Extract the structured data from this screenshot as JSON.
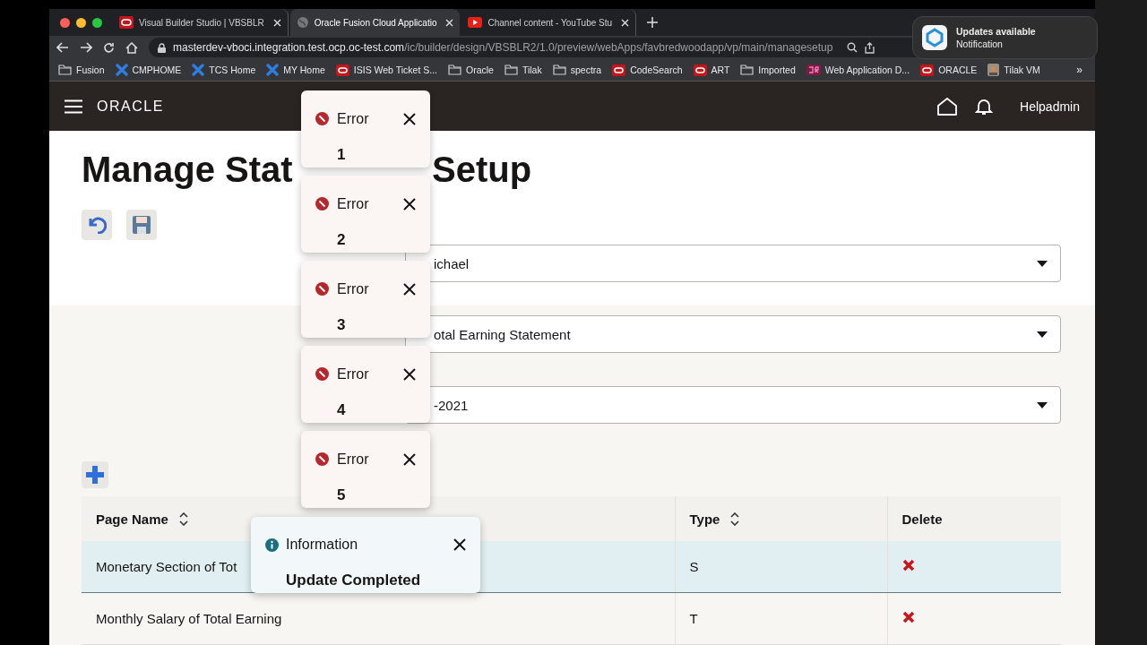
{
  "desktop_notification": {
    "title": "Updates available",
    "subtitle": "Notification"
  },
  "browser": {
    "tabs": [
      {
        "title": "Visual Builder Studio | VBSBLR",
        "selected": false
      },
      {
        "title": "Oracle Fusion Cloud Applicatio",
        "selected": true
      },
      {
        "title": "Channel content - YouTube Stu",
        "selected": false
      }
    ],
    "url_host": "masterdev-vboci.integration.test.ocp.oc-test.com",
    "url_path": "/ic/builder/design/VBSBLR2/1.0/preview/webApps/favbredwoodapp/vp/main/managesetup",
    "bookmarks": [
      {
        "label": "Fusion",
        "kind": "folder"
      },
      {
        "label": "CMPHOME",
        "kind": "cross"
      },
      {
        "label": "TCS Home",
        "kind": "cross"
      },
      {
        "label": "MY Home",
        "kind": "cross"
      },
      {
        "label": "ISIS Web Ticket S...",
        "kind": "oval"
      },
      {
        "label": "Oracle",
        "kind": "folder"
      },
      {
        "label": "Tilak",
        "kind": "folder"
      },
      {
        "label": "spectra",
        "kind": "folder"
      },
      {
        "label": "CodeSearch",
        "kind": "oval"
      },
      {
        "label": "ART",
        "kind": "oval"
      },
      {
        "label": "Imported",
        "kind": "folder"
      },
      {
        "label": "Web Application D...",
        "kind": "tile"
      },
      {
        "label": "ORACLE",
        "kind": "oval"
      },
      {
        "label": "Tilak VM",
        "kind": "thumb"
      }
    ],
    "overflow": "»"
  },
  "app": {
    "logo": "ORACLE",
    "user": "Helpadmin",
    "title_parts": [
      "Manage Stat",
      "Setup"
    ],
    "fields": [
      {
        "value": "ichael"
      },
      {
        "value": "otal Earning Statement"
      },
      {
        "value": "-2021"
      }
    ],
    "table": {
      "columns": [
        {
          "label": "Page Name",
          "sortable": true
        },
        {
          "label": "Type",
          "sortable": true
        },
        {
          "label": "Delete",
          "sortable": false
        }
      ],
      "rows": [
        {
          "cells": [
            "Monetary Section of Tot",
            "S"
          ],
          "selected": true
        },
        {
          "cells": [
            "Monthly Salary of Total Earning",
            "T"
          ],
          "selected": false
        }
      ]
    }
  },
  "toasts": [
    {
      "kind": "error",
      "title": "Error",
      "message": "1"
    },
    {
      "kind": "error",
      "title": "Error",
      "message": "2"
    },
    {
      "kind": "error",
      "title": "Error",
      "message": "3"
    },
    {
      "kind": "error",
      "title": "Error",
      "message": "4"
    },
    {
      "kind": "error",
      "title": "Error",
      "message": "5"
    },
    {
      "kind": "info",
      "title": "Information",
      "message": "Update Completed"
    }
  ]
}
